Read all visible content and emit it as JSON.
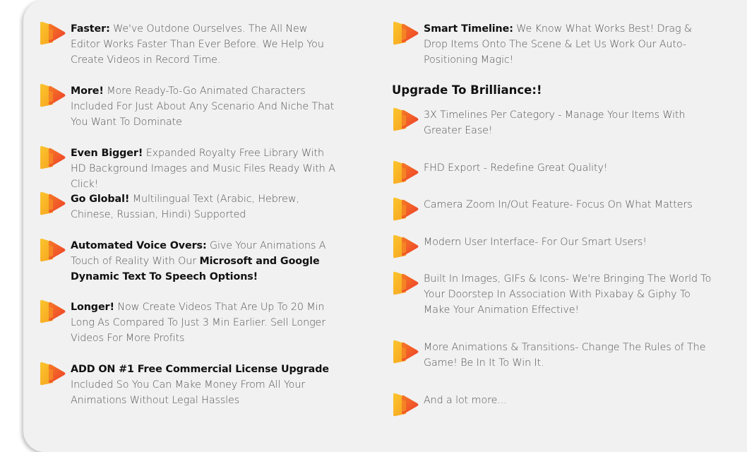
{
  "colors": {
    "background": "#f1f1f1",
    "icon_gold": "#f8b92a",
    "icon_orange": "#f25c27",
    "text": "#555555",
    "heading": "#111111"
  },
  "left_features": [
    {
      "bold": "Faster:",
      "text": " We've Outdone Ourselves. The All New Editor Works Faster Than Ever Before. We Help You Create Videos in Record Time."
    },
    {
      "bold": "More!",
      "text": " More Ready-To-Go Animated Characters Included For Just About Any Scenario And Niche That You Want To Dominate"
    },
    {
      "bold": "Even Bigger!",
      "text": " Expanded Royalty Free Library With HD Background Images and Music Files Ready With A Click!"
    },
    {
      "bold": "Go Global!",
      "text": " Multilingual Text (Arabic, Hebrew, Chinese, Russian, Hindi) Supported"
    },
    {
      "bold": "Automated Voice Overs:",
      "text": " Give Your Animations A Touch of Reality With Our ",
      "bold2": "Microsoft and Google Dynamic Text To Speech Options!"
    },
    {
      "bold": "Longer!",
      "text": " Now Create Videos That Are Up To 20 Min Long As Compared To Just 3 Min Earlier. Sell Longer Videos For More Profits"
    },
    {
      "bold": "ADD ON #1 Free Commercial License Upgrade",
      "text": " Included So You Can Make Money From All Your Animations Without Legal Hassles"
    }
  ],
  "smart_timeline": {
    "bold": "Smart Timeline:",
    "text": " We Know What Works Best! Drag & Drop Items Onto The Scene & Let Us Work Our Auto-Positioning Magic!"
  },
  "upgrade_heading": "Upgrade To Brilliance:!",
  "upgrade_features": [
    "3X Timelines Per Category - Manage Your Items With Greater Ease!",
    "FHD Export - Redefine Great Quality!",
    "Camera Zoom In/Out Feature- Focus On What Matters",
    "Modern User Interface- For Our Smart Users!",
    "Built In Images, GIFs & Icons- We're Bringing The World To Your Doorstep In Association With Pixabay & Giphy To Make Your Animation Effective!",
    "More Animations & Transitions- Change The Rules of The Game! Be In It To Win It.",
    "And a lot more..."
  ],
  "icon_name": "play-arrow-icon"
}
